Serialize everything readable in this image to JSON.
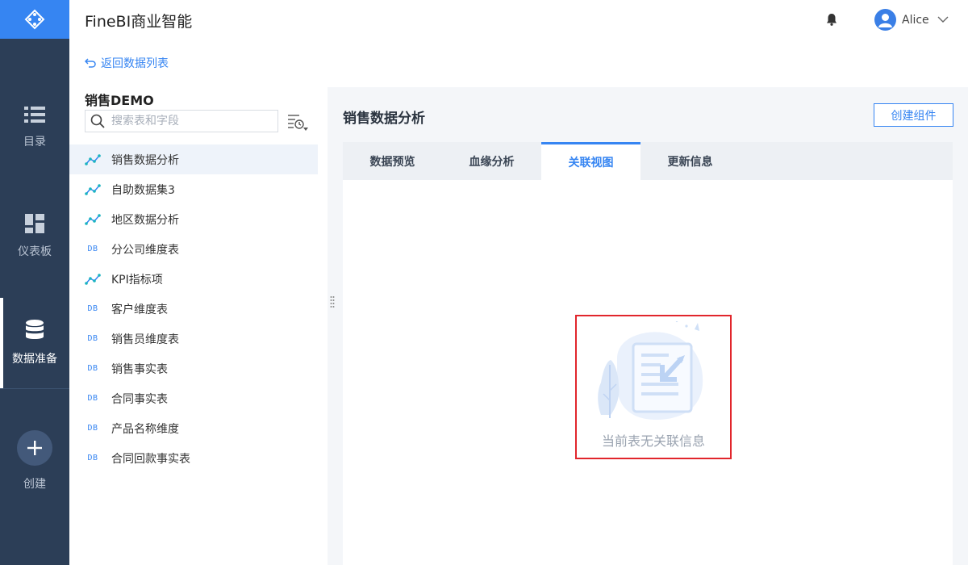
{
  "app": {
    "title": "FineBI商业智能"
  },
  "nav": {
    "items": [
      {
        "label": "目录",
        "icon": "list-icon"
      },
      {
        "label": "仪表板",
        "icon": "dashboard-icon"
      },
      {
        "label": "数据准备",
        "icon": "database-icon",
        "active": true
      },
      {
        "label": "创建",
        "icon": "plus-icon"
      }
    ]
  },
  "header": {
    "username": "Alice"
  },
  "sidebar": {
    "back_label": "返回数据列表",
    "group_title": "销售DEMO",
    "search_placeholder": "搜索表和字段",
    "tables": [
      {
        "name": "销售数据分析",
        "type": "self-service",
        "selected": true
      },
      {
        "name": "自助数据集3",
        "type": "self-service"
      },
      {
        "name": "地区数据分析",
        "type": "self-service"
      },
      {
        "name": "分公司维度表",
        "type": "db",
        "badge": "DB"
      },
      {
        "name": "KPI指标项",
        "type": "self-service"
      },
      {
        "name": "客户维度表",
        "type": "db",
        "badge": "DB"
      },
      {
        "name": "销售员维度表",
        "type": "db",
        "badge": "DB"
      },
      {
        "name": "销售事实表",
        "type": "db",
        "badge": "DB"
      },
      {
        "name": "合同事实表",
        "type": "db",
        "badge": "DB"
      },
      {
        "name": "产品名称维度",
        "type": "db",
        "badge": "DB"
      },
      {
        "name": "合同回款事实表",
        "type": "db",
        "badge": "DB"
      }
    ]
  },
  "main": {
    "title": "销售数据分析",
    "create_button": "创建组件",
    "tabs": [
      {
        "label": "数据预览"
      },
      {
        "label": "血缘分析"
      },
      {
        "label": "关联视图",
        "active": true
      },
      {
        "label": "更新信息"
      }
    ],
    "empty_message": "当前表无关联信息"
  },
  "colors": {
    "accent": "#3685f2",
    "nav_bg": "#2c3e57",
    "highlight_border": "#e1262c"
  }
}
